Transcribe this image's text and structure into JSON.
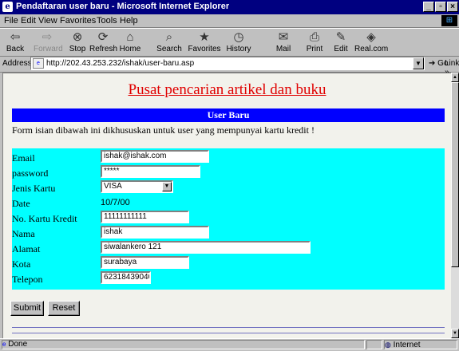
{
  "window": {
    "title": "Pendaftaran user baru - Microsoft Internet Explorer",
    "minimize": "_",
    "maximize": "▫",
    "close": "×"
  },
  "menu": [
    "File",
    "Edit",
    "View",
    "Favorites",
    "Tools",
    "Help"
  ],
  "toolbar": {
    "back": "Back",
    "forward": "Forward",
    "stop": "Stop",
    "refresh": "Refresh",
    "home": "Home",
    "search": "Search",
    "favorites": "Favorites",
    "history": "History",
    "mail": "Mail",
    "print": "Print",
    "edit": "Edit",
    "realcom": "Real.com"
  },
  "address": {
    "label": "Address",
    "url": "http://202.43.253.232/ishak/user-baru.asp",
    "go": "Go",
    "links": "Links »"
  },
  "page": {
    "heading": "Pusat pencarian artikel dan buku",
    "band_title": "User Baru",
    "note": "Form isian dibawah ini dikhususkan untuk user yang mempunyai kartu kredit !",
    "fields": {
      "email": {
        "label": "Email",
        "value": "ishak@ishak.com"
      },
      "password": {
        "label": "password",
        "value": "*****"
      },
      "card_type": {
        "label": "Jenis Kartu",
        "value": "VISA"
      },
      "date": {
        "label": "Date",
        "value": "10/7/00"
      },
      "card_no": {
        "label": "No. Kartu Kredit",
        "value": "11111111111"
      },
      "name": {
        "label": "Nama",
        "value": "ishak"
      },
      "address": {
        "label": "Alamat",
        "value": "siwalankero 121"
      },
      "city": {
        "label": "Kota",
        "value": "surabaya"
      },
      "phone": {
        "label": "Telepon",
        "value": "62318439040"
      }
    },
    "submit": "Submit",
    "reset": "Reset"
  },
  "status": {
    "text": "Done",
    "zone": "Internet"
  },
  "colors": {
    "title_bar": "#000080",
    "heading": "#e00000",
    "band": "#0000ff",
    "form_bg": "#00ffff"
  }
}
